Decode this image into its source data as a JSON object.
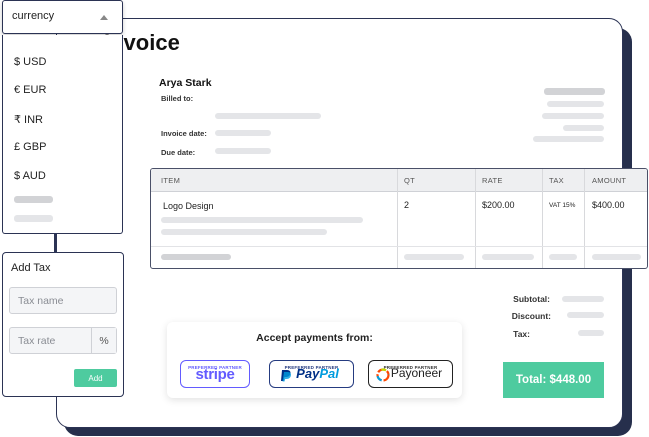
{
  "invoice": {
    "title": "Invoice",
    "billed_to_label": "Billed to:",
    "client_name": "Arya Stark",
    "invoice_date_label": "Invoice date:",
    "due_date_label": "Due date:"
  },
  "table": {
    "headers": [
      "ITEM",
      "QT",
      "RATE",
      "TAX",
      "AMOUNT"
    ],
    "rows": [
      {
        "item": "Logo Design",
        "qt": "2",
        "rate": "$200.00",
        "tax": "VAT 15%",
        "amount": "$400.00"
      }
    ]
  },
  "totals": {
    "subtotal_label": "Subtotal:",
    "discount_label": "Discount:",
    "tax_label": "Tax:",
    "total_label": "Total: $448.00"
  },
  "payments": {
    "title": "Accept payments from:",
    "partner_tag": "PREFERRED PARTNER",
    "partners": [
      "stripe",
      "PayPal",
      "Payoneer"
    ]
  },
  "currency_dropdown": {
    "selected": "currency",
    "options": [
      "$ USD",
      "€ EUR",
      "₹ INR",
      "£ GBP",
      "$ AUD"
    ]
  },
  "tax_panel": {
    "title": "Add Tax",
    "tax_name_placeholder": "Tax name",
    "tax_rate_placeholder": "Tax rate",
    "rate_unit": "%",
    "add_label": "Add"
  },
  "colors": {
    "accent_green": "#4ecb9f",
    "navy": "#262f4c",
    "stripe": "#635bff",
    "paypal_dark": "#003087",
    "paypal_light": "#009cde"
  }
}
